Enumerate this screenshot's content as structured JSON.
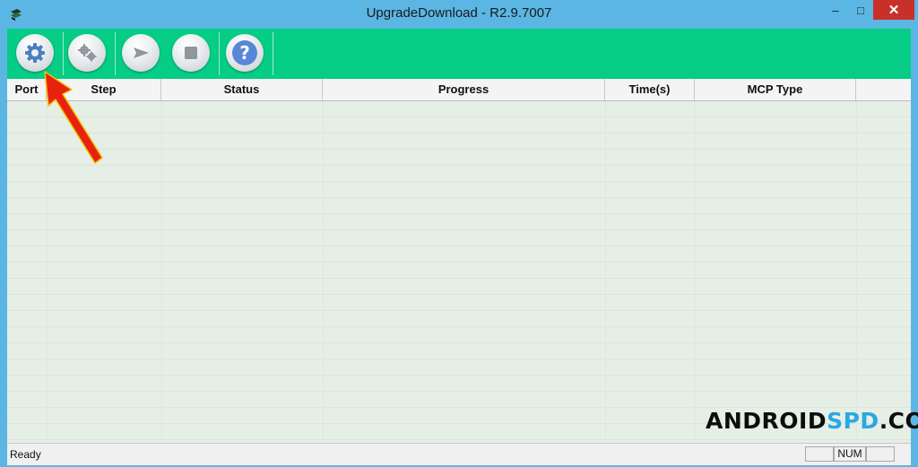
{
  "window": {
    "title": "UpgradeDownload - R2.9.7007",
    "controls": {
      "minimize": "–",
      "maximize": "□",
      "close": "✕"
    }
  },
  "toolbar": {
    "buttons": [
      {
        "name": "settings-gear-icon",
        "tooltip": ""
      },
      {
        "name": "multi-gear-icon",
        "tooltip": ""
      },
      {
        "name": "play-arrow-icon",
        "tooltip": ""
      },
      {
        "name": "stop-square-icon",
        "tooltip": ""
      },
      {
        "name": "help-question-icon",
        "label": "?"
      }
    ],
    "accent": "#05cd85"
  },
  "list": {
    "columns": [
      "Port",
      "Step",
      "Status",
      "Progress",
      "Time(s)",
      "MCP Type"
    ],
    "rows": []
  },
  "statusbar": {
    "text": "Ready",
    "panes": [
      "",
      "NUM",
      ""
    ]
  },
  "watermark": {
    "part1": "ANDROID",
    "part2": "SPD",
    "part3": ".COM"
  },
  "annotation": {
    "arrow_color": "#e8220f"
  }
}
